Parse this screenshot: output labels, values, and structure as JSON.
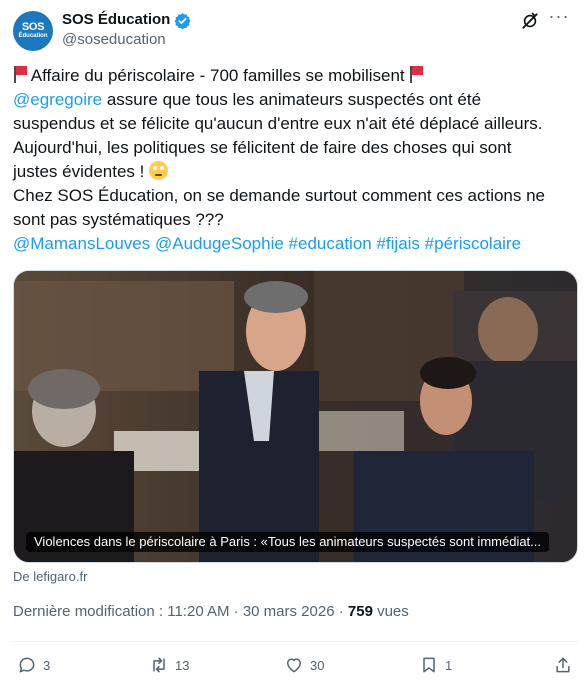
{
  "author": {
    "display_name": "SOS Éducation",
    "handle": "@soseducation",
    "avatar_text_top": "SOS",
    "avatar_text_bottom": "Éducation",
    "avatar_color": "#1d78bd",
    "verified_icon": "verified-badge-icon"
  },
  "tweet": {
    "headline": "Affaire du périscolaire - 700 familles se mobilisent",
    "mention": "@egregoire",
    "line2_rest": " assure que tous les animateurs suspectés ont été",
    "line3": "suspendus et se félicite qu'aucun d'entre eux n'ait été déplacé ailleurs.",
    "line4": "Aujourd'hui, les politiques se félicitent de faire des choses qui sont",
    "line5": "justes évidentes ! ",
    "line6": "Chez SOS Éducation, on se demande surtout comment ces actions ne",
    "line7": "sont pas systématiques ???",
    "tags": [
      "@MamansLouves",
      "@AudugeSophie",
      "#education",
      "#fijais",
      "#périscolaire"
    ],
    "link_color": "#1d9bf0"
  },
  "card": {
    "caption": "Violences dans le périscolaire à Paris : «Tous les animateurs suspectés sont immédiat...",
    "source": "De lefigaro.fr"
  },
  "meta": {
    "prefix": "Dernière modification : 11:20 AM · 30 mars 2026 · ",
    "views_count": "759",
    "views_label": " vues"
  },
  "actions": {
    "replies": "3",
    "reposts": "13",
    "likes": "30",
    "bookmarks": "1"
  }
}
